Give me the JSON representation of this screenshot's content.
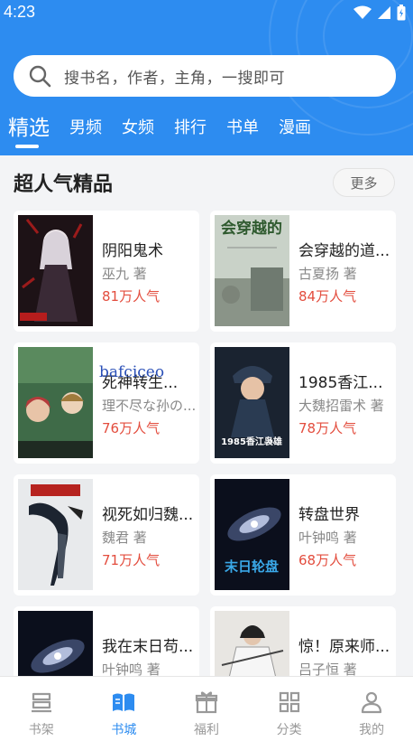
{
  "status": {
    "time": "4:23"
  },
  "search": {
    "placeholder": "搜书名，作者，主角，一搜即可"
  },
  "tabs": [
    {
      "label": "精选",
      "active": true
    },
    {
      "label": "男频"
    },
    {
      "label": "女频"
    },
    {
      "label": "排行"
    },
    {
      "label": "书单"
    },
    {
      "label": "漫画"
    }
  ],
  "section": {
    "title": "超人气精品",
    "more_label": "更多"
  },
  "books": [
    {
      "title": "阴阳鬼术",
      "author": "巫九 著",
      "popularity": "81万人气",
      "cover_icon": "ghost-girl-cover"
    },
    {
      "title": "会穿越的道...",
      "author": "古夏扬 著",
      "popularity": "84万人气",
      "cover_icon": "ruins-cover",
      "cover_text": "会穿越的"
    },
    {
      "title": "死神转生...",
      "author": "理不尽な孙の...",
      "popularity": "76万人气",
      "cover_icon": "anime-cover"
    },
    {
      "title": "1985香江...",
      "author": "大魏招雷术 著",
      "popularity": "78万人气",
      "cover_icon": "police-cover",
      "cover_text": "1985香江袅雄"
    },
    {
      "title": "视死如归魏...",
      "author": "魏君 著",
      "popularity": "71万人气",
      "cover_icon": "ink-cover"
    },
    {
      "title": "转盘世界",
      "author": "叶钟鸣 著",
      "popularity": "68万人气",
      "cover_icon": "galaxy-cover",
      "cover_text": "末日轮盘"
    },
    {
      "title": "我在末日苟...",
      "author": "叶钟鸣 著",
      "popularity": "",
      "cover_icon": "galaxy-cover"
    },
    {
      "title": "惊！原来师...",
      "author": "吕子恒 著",
      "popularity": "",
      "cover_icon": "swordsman-cover"
    }
  ],
  "watermark": "bafciceo",
  "bottom_nav": [
    {
      "label": "书架",
      "icon": "bookshelf-icon"
    },
    {
      "label": "书城",
      "icon": "book-open-icon",
      "active": true
    },
    {
      "label": "福利",
      "icon": "gift-icon"
    },
    {
      "label": "分类",
      "icon": "grid-icon"
    },
    {
      "label": "我的",
      "icon": "user-icon"
    }
  ],
  "colors": {
    "primary": "#2d8cf0",
    "popularity": "#e34d3e"
  }
}
